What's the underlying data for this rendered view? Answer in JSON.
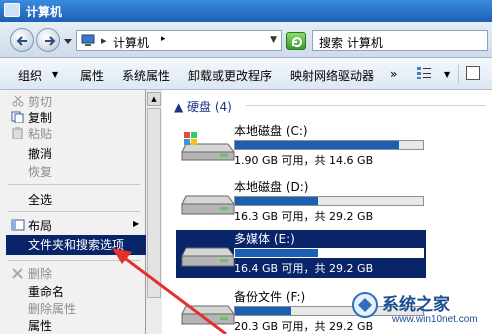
{
  "window": {
    "title": "计算机"
  },
  "address": {
    "crumb": "计算机",
    "search_text": "搜索 计算机"
  },
  "toolbar": {
    "organize": "组织",
    "properties": "属性",
    "system_properties": "系统属性",
    "uninstall": "卸载或更改程序",
    "map_drive": "映射网络驱动器",
    "more": "»"
  },
  "menu": {
    "items": [
      {
        "label": "剪切",
        "disabled": true
      },
      {
        "label": "复制",
        "disabled": false
      },
      {
        "label": "粘贴",
        "disabled": true
      },
      {
        "label": "撤消",
        "disabled": false
      },
      {
        "label": "恢复",
        "disabled": true
      },
      {
        "label": "全选",
        "disabled": false
      },
      {
        "label": "布局",
        "disabled": false
      },
      {
        "label": "文件夹和搜索选项",
        "disabled": false
      },
      {
        "label": "删除",
        "disabled": true
      },
      {
        "label": "重命名",
        "disabled": false
      },
      {
        "label": "删除属性",
        "disabled": true
      },
      {
        "label": "属性",
        "disabled": false
      }
    ]
  },
  "content": {
    "group_header": "硬盘 (4)",
    "drives": [
      {
        "name": "本地磁盘 (C:)",
        "free": "1.90 GB 可用，共 14.6 GB",
        "used_fraction": 0.87
      },
      {
        "name": "本地磁盘 (D:)",
        "free": "16.3 GB 可用，共 29.2 GB",
        "used_fraction": 0.44
      },
      {
        "name": "多媒体 (E:)",
        "free": "16.4 GB 可用，共 29.2 GB",
        "used_fraction": 0.44
      },
      {
        "name": "备份文件 (F:)",
        "free": "20.3 GB 可用，共 29.2 GB",
        "used_fraction": 0.3
      }
    ]
  },
  "watermark": {
    "title": "系统之家",
    "url": "www.win10net.com"
  },
  "colors": {
    "highlight": "#0a246a",
    "titlebar": "#1e5fb3",
    "annotation_arrow": "#e53030",
    "bar_fill": "#1a5fb4"
  }
}
